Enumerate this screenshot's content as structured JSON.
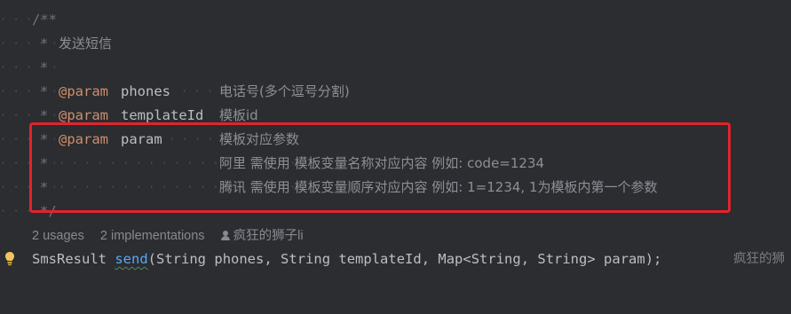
{
  "doc_comment": {
    "open": "/**",
    "summary": "发送短信",
    "params": [
      {
        "tag": "@param",
        "name": "phones",
        "desc": "电话号(多个逗号分割)"
      },
      {
        "tag": "@param",
        "name": "templateId",
        "desc": "模板id"
      },
      {
        "tag": "@param",
        "name": "param",
        "desc": "模板对应参数"
      }
    ],
    "continuation": [
      "阿里 需使用 模板变量名称对应内容 例如: code=1234",
      "腾讯 需使用 模板变量顺序对应内容 例如: 1=1234, 1为模板内第一个参数"
    ],
    "close": "*/"
  },
  "hints": {
    "usages": "2 usages",
    "implementations": "2 implementations",
    "author": "疯狂的狮子li"
  },
  "code": {
    "return_type": "SmsResult",
    "method": "send",
    "open_paren": "(",
    "p1_type": "String",
    "p1_name": "phones",
    "p2_type": "String",
    "p2_name": "templateId",
    "p3_type": "Map<String, String>",
    "p3_name": "param",
    "close": ");",
    "inlay_author": "疯狂的狮"
  },
  "colors": {
    "background": "#2b2d30",
    "highlight_border": "#e3232c",
    "javadoc_tag": "#cf8e6d",
    "method_name": "#56a8f5"
  }
}
